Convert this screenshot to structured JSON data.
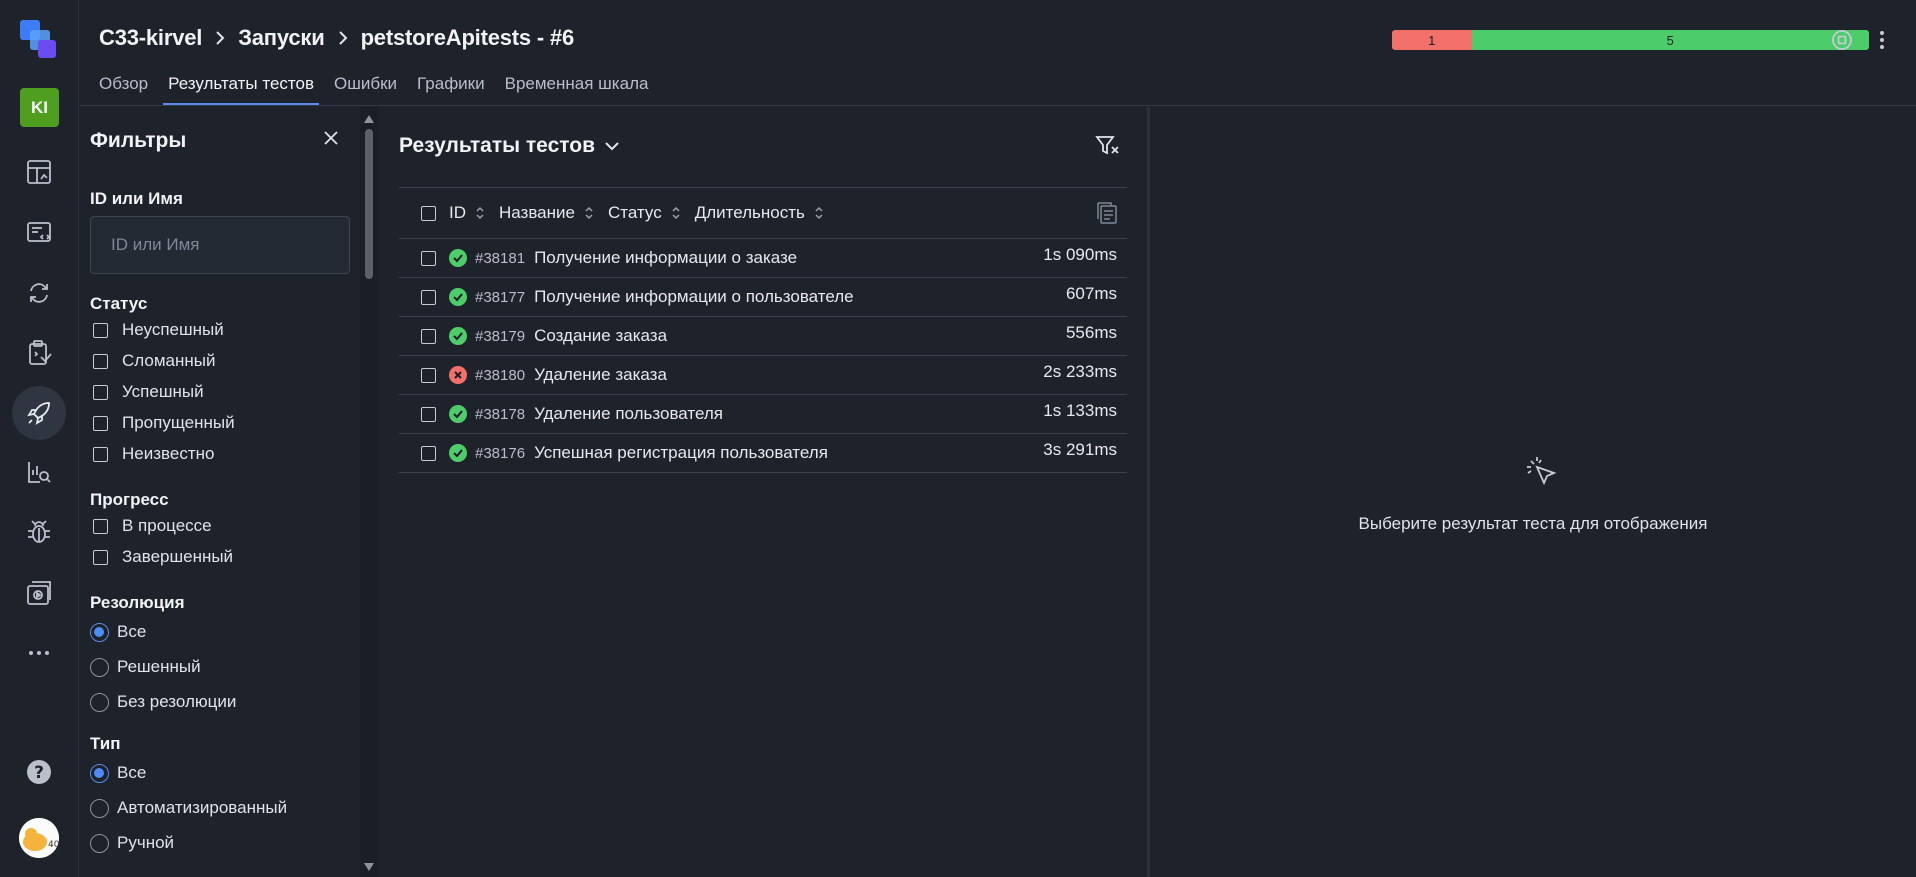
{
  "rail": {
    "avatar_initials": "KI",
    "user_avatar_badge": "40",
    "items": [
      {
        "icon": "dashboards-icon"
      },
      {
        "icon": "test-cases-icon"
      },
      {
        "icon": "sync-icon"
      },
      {
        "icon": "test-plans-icon"
      },
      {
        "icon": "launches-icon",
        "active": true
      },
      {
        "icon": "analytics-search-icon"
      },
      {
        "icon": "defects-bug-icon"
      },
      {
        "icon": "jobs-icon"
      },
      {
        "icon": "more-icon"
      },
      {
        "icon": "help-icon"
      }
    ]
  },
  "header": {
    "breadcrumb": [
      "C33-kirvel",
      "Запуски",
      "petstoreApitests - #6"
    ],
    "tabs": [
      {
        "label": "Обзор",
        "active": false
      },
      {
        "label": "Результаты тестов",
        "active": true
      },
      {
        "label": "Ошибки",
        "active": false
      },
      {
        "label": "Графики",
        "active": false
      },
      {
        "label": "Временная шкала",
        "active": false
      }
    ],
    "progress": {
      "failed": "1",
      "passed": "5",
      "failed_color": "#f3706a",
      "passed_color": "#4ccd6a",
      "failed_fraction": 0.1667
    }
  },
  "filters": {
    "title": "Фильтры",
    "id_name": {
      "label": "ID или Имя",
      "placeholder": "ID или Имя",
      "value": ""
    },
    "status": {
      "label": "Статус",
      "options": [
        "Неуспешный",
        "Сломанный",
        "Успешный",
        "Пропущенный",
        "Неизвестно"
      ]
    },
    "progress": {
      "label": "Прогресс",
      "options": [
        "В процессе",
        "Завершенный"
      ]
    },
    "resolution": {
      "label": "Резолюция",
      "options": [
        "Все",
        "Решенный",
        "Без резолюции"
      ],
      "selected": "Все"
    },
    "type": {
      "label": "Тип",
      "options": [
        "Все",
        "Автоматизированный",
        "Ручной"
      ],
      "selected": "Все"
    }
  },
  "results": {
    "title": "Результаты тестов",
    "columns": [
      "ID",
      "Название",
      "Статус",
      "Длительность"
    ],
    "rows": [
      {
        "status": "passed",
        "id": "#38181",
        "name": "Получение информации о заказе",
        "duration": "1s 090ms"
      },
      {
        "status": "passed",
        "id": "#38177",
        "name": "Получение информации о пользователе",
        "duration": "607ms"
      },
      {
        "status": "passed",
        "id": "#38179",
        "name": "Создание заказа",
        "duration": "556ms"
      },
      {
        "status": "failed",
        "id": "#38180",
        "name": "Удаление заказа",
        "duration": "2s 233ms"
      },
      {
        "status": "passed",
        "id": "#38178",
        "name": "Удаление пользователя",
        "duration": "1s 133ms"
      },
      {
        "status": "passed",
        "id": "#38176",
        "name": "Успешная регистрация пользователя",
        "duration": "3s 291ms"
      }
    ],
    "colors": {
      "passed": "#4ccd6a",
      "failed": "#f3706a"
    }
  },
  "detail": {
    "empty_text": "Выберите результат теста для отображения"
  }
}
